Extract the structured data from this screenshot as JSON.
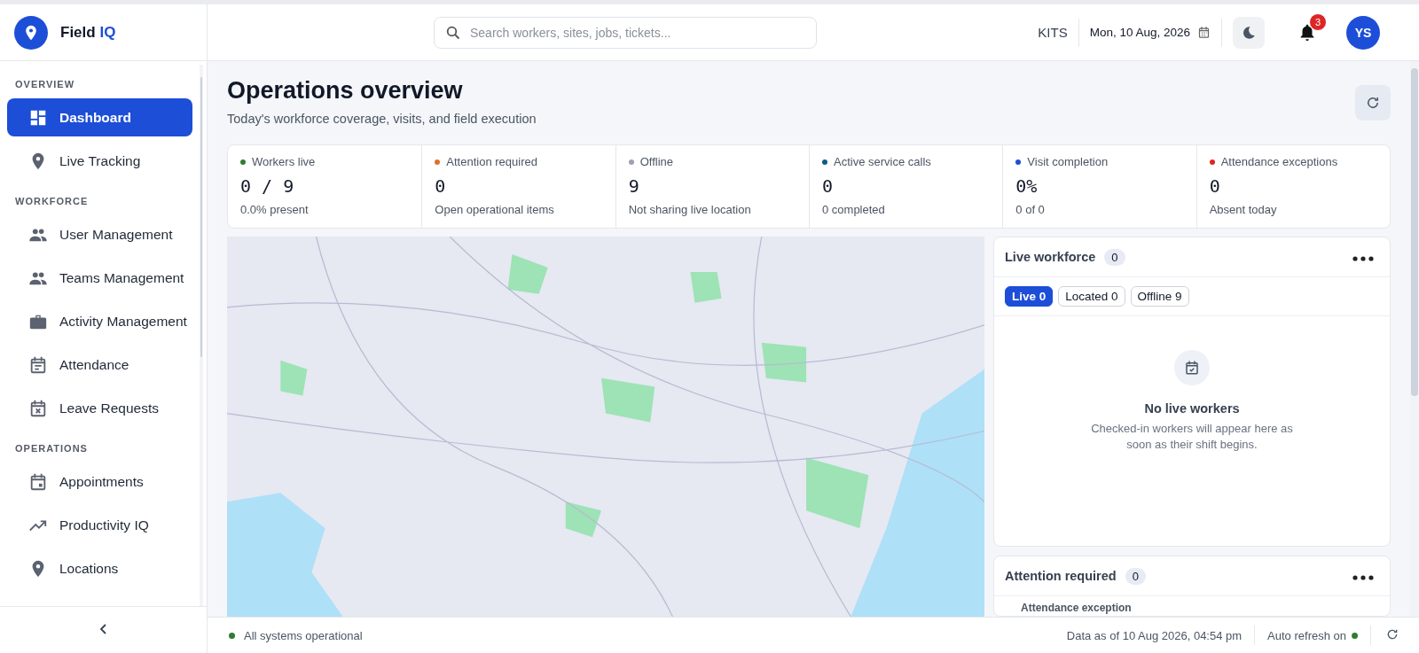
{
  "brand": {
    "name": "Field",
    "highlight": "IQ"
  },
  "sidebar": {
    "sections": [
      {
        "title": "OVERVIEW",
        "items": [
          {
            "label": "Dashboard",
            "selected": true
          },
          {
            "label": "Live Tracking",
            "selected": false
          }
        ]
      },
      {
        "title": "WORKFORCE",
        "items": [
          {
            "label": "User Management",
            "selected": false
          },
          {
            "label": "Teams Management",
            "selected": false
          },
          {
            "label": "Activity Management",
            "selected": false
          },
          {
            "label": "Attendance",
            "selected": false
          },
          {
            "label": "Leave Requests",
            "selected": false
          }
        ]
      },
      {
        "title": "OPERATIONS",
        "items": [
          {
            "label": "Appointments",
            "selected": false
          },
          {
            "label": "Productivity IQ",
            "selected": false
          },
          {
            "label": "Locations",
            "selected": false
          }
        ]
      }
    ]
  },
  "topbar": {
    "search": {
      "placeholder": "Search workers, sites, jobs, tickets..."
    },
    "org": "KITS",
    "date": "Mon, 10 Aug, 2026",
    "notifications": "3",
    "avatar": "YS"
  },
  "page": {
    "title": "Operations overview",
    "subtitle": "Today's workforce coverage, visits, and field execution"
  },
  "stats": [
    {
      "label": "Workers live",
      "value": "0 / 9",
      "note": "0.0% present",
      "color": "#2e7d32"
    },
    {
      "label": "Attention required",
      "value": "0",
      "note": "Open operational items",
      "color": "#e0702a"
    },
    {
      "label": "Offline",
      "value": "9",
      "note": "Not sharing live location",
      "color": "#9ca3af"
    },
    {
      "label": "Active service calls",
      "value": "0",
      "note": "0 completed",
      "color": "#0b5e8a"
    },
    {
      "label": "Visit completion",
      "value": "0%",
      "note": "0 of 0",
      "color": "#1d4ed8"
    },
    {
      "label": "Attendance exceptions",
      "value": "0",
      "note": "Absent today",
      "color": "#dc2626"
    }
  ],
  "live_workforce": {
    "title": "Live workforce",
    "count": "0",
    "filters": [
      {
        "label": "Live 0",
        "selected": true
      },
      {
        "label": "Located 0",
        "selected": false
      },
      {
        "label": "Offline 9",
        "selected": false
      }
    ],
    "empty_title": "No live workers",
    "empty_text": "Checked-in workers will appear here as soon as their shift begins."
  },
  "attention": {
    "title": "Attention required",
    "count": "0",
    "first_item": "Attendance exception"
  },
  "footer": {
    "status": "All systems operational",
    "data_as_of": "Data as of 10 Aug 2026, 04:54 pm",
    "auto_refresh": "Auto refresh on"
  }
}
